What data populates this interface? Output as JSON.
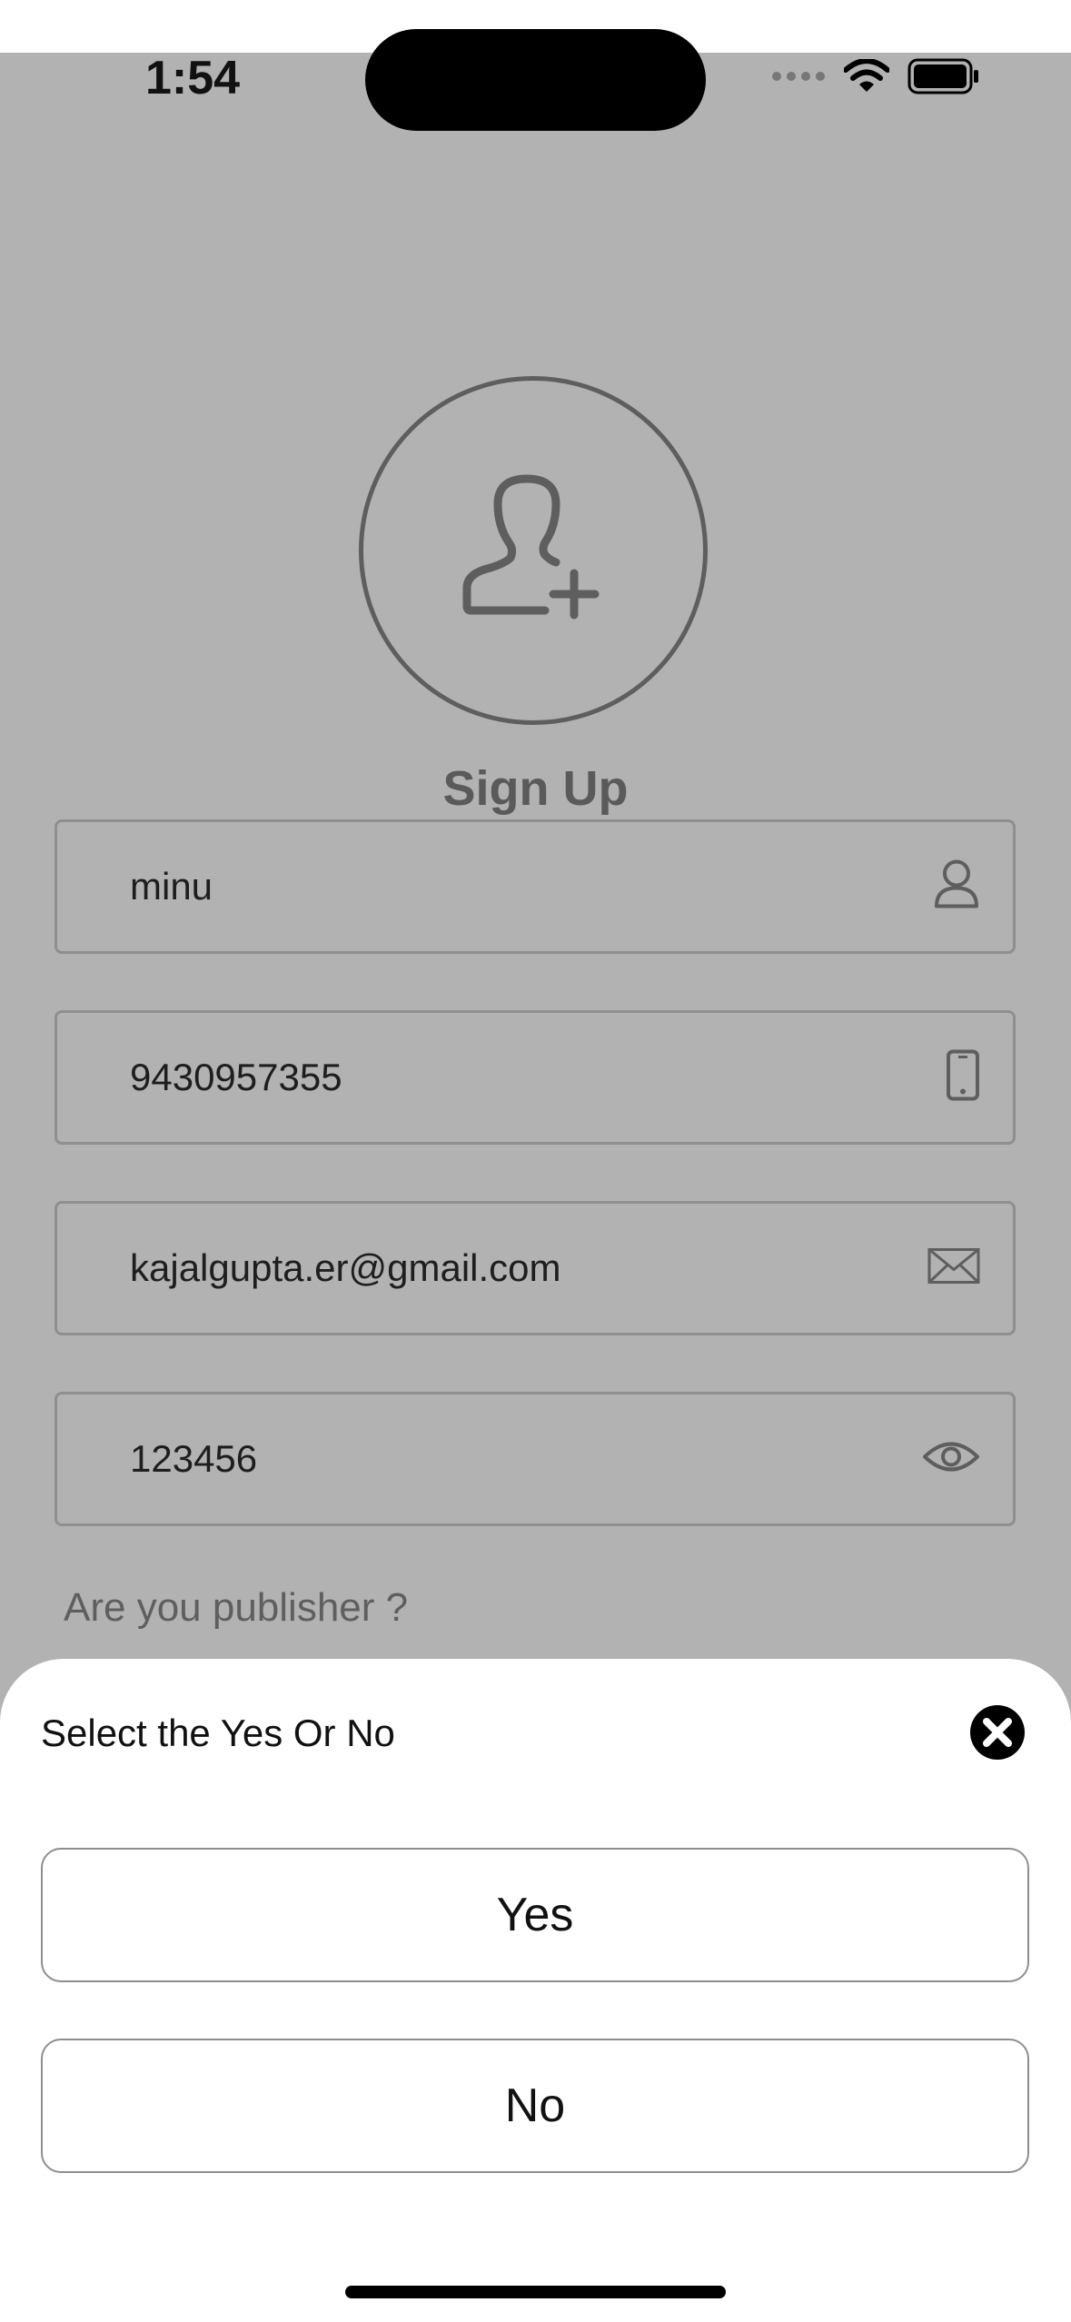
{
  "status_bar": {
    "time": "1:54",
    "icons": [
      "cellular-icon",
      "wifi-icon",
      "battery-icon"
    ]
  },
  "header": {
    "avatar_icon": "add-user-icon",
    "title": "Sign Up"
  },
  "form": {
    "name": {
      "value": "minu",
      "icon": "person-icon"
    },
    "phone": {
      "value": "9430957355",
      "icon": "phone-icon"
    },
    "email": {
      "value": "kajalgupta.er@gmail.com",
      "icon": "envelope-icon"
    },
    "password": {
      "value": "123456",
      "icon": "eye-icon"
    },
    "publisher_question": "Are you publisher ?"
  },
  "sheet": {
    "title": "Select the Yes Or No",
    "close_icon": "close-circle-icon",
    "options": [
      {
        "label": "Yes"
      },
      {
        "label": "No"
      }
    ]
  },
  "colors": {
    "dim_background": "#b2b2b2",
    "sheet_background": "#ffffff",
    "icon_gray": "#5e5e5e"
  }
}
